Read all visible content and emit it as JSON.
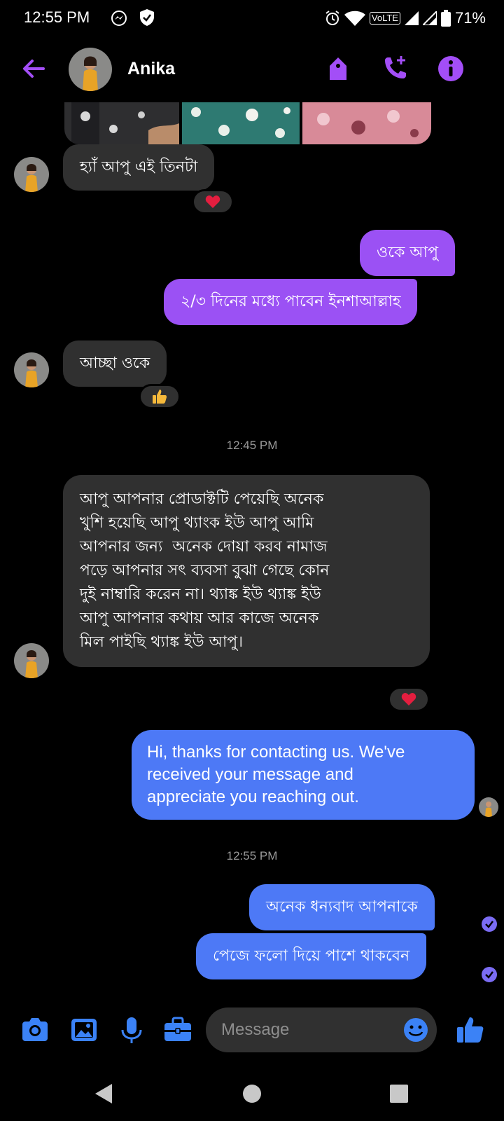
{
  "status_bar": {
    "time": "12:55 PM",
    "volte": "VoLTE",
    "battery": "71%"
  },
  "header": {
    "contact_name": "Anika"
  },
  "messages": [
    {
      "from": "contact",
      "text": "হ্যাঁ আপু এই তিনটা",
      "reaction": "heart"
    },
    {
      "from": "me",
      "text": "ওকে আপু"
    },
    {
      "from": "me",
      "text": "২/৩ দিনের মধ্যে পাবেন ইনশাআল্লাহ"
    },
    {
      "from": "contact",
      "text": "আচ্ছা ওকে",
      "reaction": "thumbs-up"
    },
    {
      "from": "contact",
      "lines": [
        "আপু আপনার প্রোডাক্টটি পেয়েছি অনেক",
        "খুশি হয়েছি আপু থ্যাংক ইউ আপু আমি",
        "আপনার জন্য  অনেক দোয়া করব নামাজ",
        "পড়ে আপনার সৎ ব্যবসা বুঝা গেছে কোন",
        "দুই নাম্বারি করেন না। থ্যাঙ্ক ইউ থ্যাঙ্ক ইউ",
        "আপু আপনার কথায় আর কাজে অনেক",
        "মিল পাইছি থ্যাঙ্ক ইউ আপু।"
      ],
      "reaction": "heart"
    },
    {
      "from": "me",
      "lines": [
        "Hi, thanks for contacting us. We've",
        "received your message and",
        "appreciate you reaching out."
      ]
    },
    {
      "from": "me",
      "text": "অনেক ধন্যবাদ আপনাকে"
    },
    {
      "from": "me",
      "text": "পেজে ফলো দিয়ে পাশে থাকবেন"
    }
  ],
  "timestamps": [
    "12:45 PM",
    "12:55 PM"
  ],
  "composer": {
    "placeholder": "Message"
  },
  "colors": {
    "accent_purple": "#9b51f4",
    "accent_blue": "#4d79f6",
    "incoming_bubble": "#303030",
    "icon_blue": "#3b82f6",
    "header_icon_purple": "#a34ef7"
  }
}
